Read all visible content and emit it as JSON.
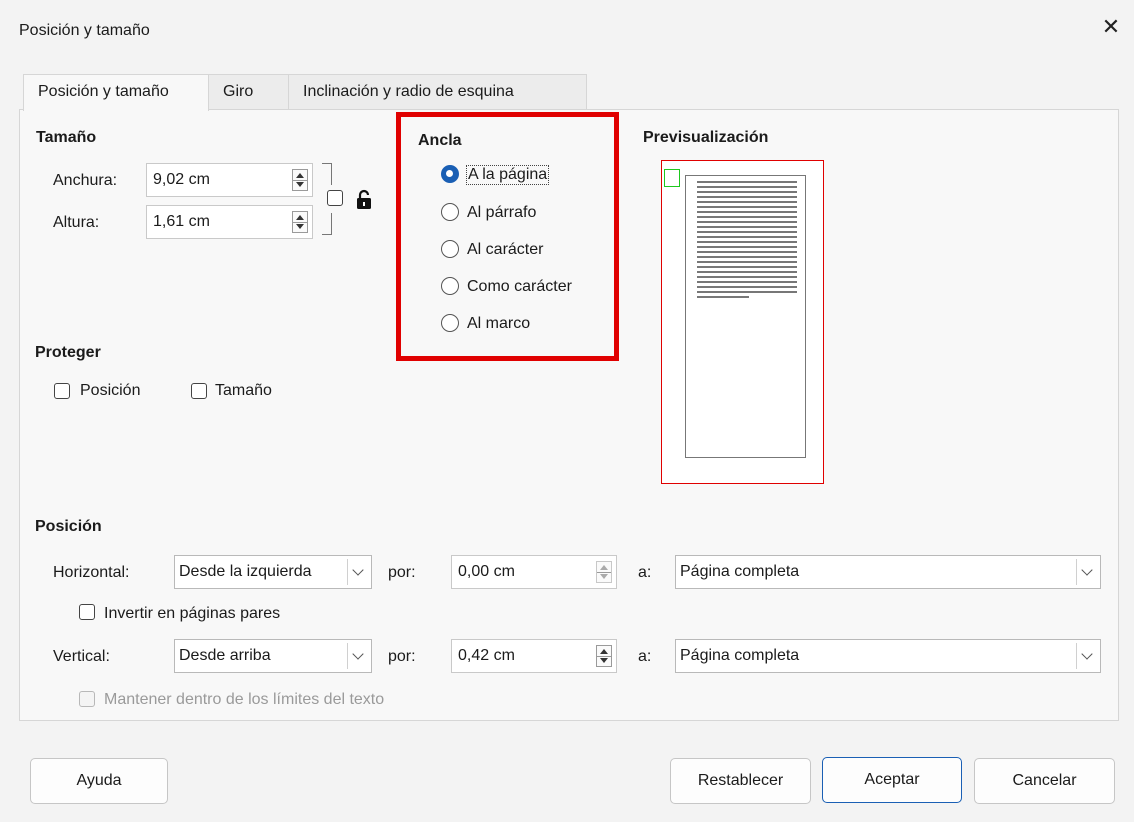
{
  "window": {
    "title": "Posición y tamaño"
  },
  "tabs": [
    {
      "label": "Posición y tamaño",
      "active": true
    },
    {
      "label": "Giro",
      "active": false
    },
    {
      "label": "Inclinación y radio de esquina",
      "active": false
    }
  ],
  "size": {
    "heading": "Tamaño",
    "width_label": "Anchura:",
    "width_value": "9,02 cm",
    "height_label": "Altura:",
    "height_value": "1,61 cm",
    "keep_ratio_checked": false,
    "lock_icon": "unlocked-padlock-icon"
  },
  "anchor": {
    "heading": "Ancla",
    "options": [
      {
        "label": "A la página",
        "selected": true
      },
      {
        "label": "Al párrafo",
        "selected": false
      },
      {
        "label": "Al carácter",
        "selected": false
      },
      {
        "label": "Como carácter",
        "selected": false
      },
      {
        "label": "Al marco",
        "selected": false
      }
    ],
    "highlight_color": "#e00000"
  },
  "preview": {
    "heading": "Previsualización"
  },
  "protect": {
    "heading": "Proteger",
    "position_label": "Posición",
    "size_label": "Tamaño",
    "position_checked": false,
    "size_checked": false
  },
  "position": {
    "heading": "Posición",
    "horizontal_label": "Horizontal:",
    "horizontal_value": "Desde la izquierda",
    "horizontal_by_label": "por:",
    "horizontal_by_value": "0,00 cm",
    "horizontal_to_label": "a:",
    "horizontal_to_value": "Página completa",
    "mirror_label": "Invertir en páginas pares",
    "mirror_checked": false,
    "vertical_label": "Vertical:",
    "vertical_value": "Desde arriba",
    "vertical_by_label": "por:",
    "vertical_by_value": "0,42 cm",
    "vertical_to_label": "a:",
    "vertical_to_value": "Página completa",
    "keep_inside_label": "Mantener dentro de los límites del texto",
    "keep_inside_enabled": false
  },
  "buttons": {
    "help": "Ayuda",
    "reset": "Restablecer",
    "ok": "Aceptar",
    "cancel": "Cancelar"
  },
  "colors": {
    "accent": "#1a5fb4",
    "preview_anchor": "#1ec81e"
  }
}
